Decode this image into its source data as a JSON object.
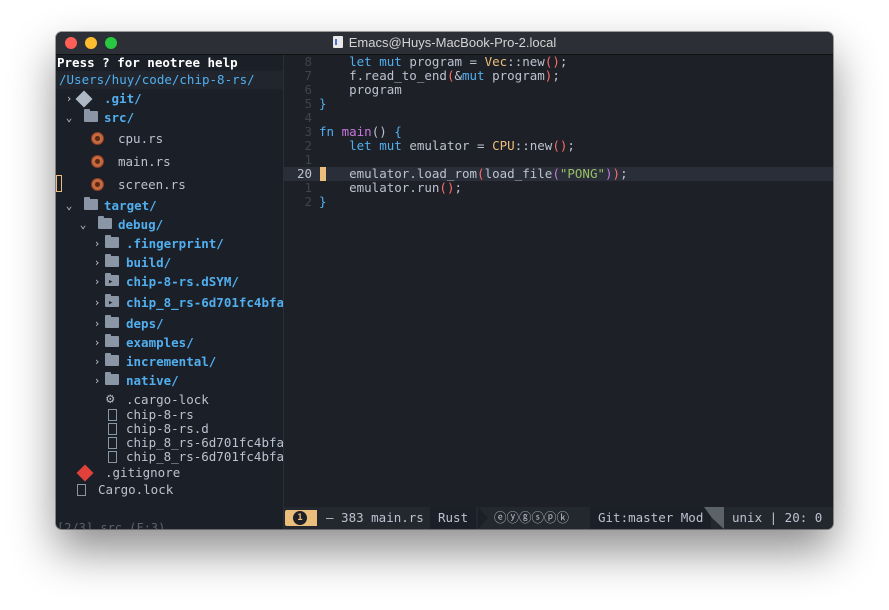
{
  "window": {
    "title": "Emacs@Huys-MacBook-Pro-2.local"
  },
  "sidebar": {
    "help": "Press ? for neotree help",
    "path": "/Users/huy/code/chip-8-rs/",
    "items": [
      {
        "label": ".git/",
        "arrow": "›",
        "icon": "git-icon",
        "kind": "dir"
      },
      {
        "label": "src/",
        "arrow": "⌄",
        "icon": "folder-icon",
        "kind": "dir"
      },
      {
        "label": "cpu.rs",
        "arrow": "",
        "icon": "rust-icon",
        "kind": "file"
      },
      {
        "label": "main.rs",
        "arrow": "",
        "icon": "rust-icon",
        "kind": "file"
      },
      {
        "label": "screen.rs",
        "arrow": "",
        "icon": "rust-icon",
        "kind": "file"
      },
      {
        "label": "target/",
        "arrow": "⌄",
        "icon": "folder-icon",
        "kind": "dir"
      },
      {
        "label": "debug/",
        "arrow": "⌄",
        "icon": "folder-icon",
        "kind": "dir"
      },
      {
        "label": ".fingerprint/",
        "arrow": "›",
        "icon": "folder-icon",
        "kind": "dir"
      },
      {
        "label": "build/",
        "arrow": "›",
        "icon": "folder-icon",
        "kind": "dir"
      },
      {
        "label": "chip-8-rs.dSYM/",
        "arrow": "›",
        "icon": "folder-symlink-icon",
        "kind": "dir"
      },
      {
        "label": "chip_8_rs-6d701fc4bfa $",
        "arrow": "›",
        "icon": "folder-symlink-icon",
        "kind": "dir"
      },
      {
        "label": "deps/",
        "arrow": "›",
        "icon": "folder-icon",
        "kind": "dir"
      },
      {
        "label": "examples/",
        "arrow": "›",
        "icon": "folder-icon",
        "kind": "dir"
      },
      {
        "label": "incremental/",
        "arrow": "›",
        "icon": "folder-icon",
        "kind": "dir"
      },
      {
        "label": "native/",
        "arrow": "›",
        "icon": "folder-icon",
        "kind": "dir"
      },
      {
        "label": ".cargo-lock",
        "arrow": "",
        "icon": "gear-icon",
        "kind": "file"
      },
      {
        "label": "chip-8-rs",
        "arrow": "",
        "icon": "file-icon",
        "kind": "file"
      },
      {
        "label": "chip-8-rs.d",
        "arrow": "",
        "icon": "file-icon",
        "kind": "file"
      },
      {
        "label": "chip_8_rs-6d701fc4bfa $",
        "arrow": "",
        "icon": "file-icon",
        "kind": "file"
      },
      {
        "label": "chip_8_rs-6d701fc4bfa $",
        "arrow": "",
        "icon": "file-icon",
        "kind": "file"
      },
      {
        "label": ".gitignore",
        "arrow": "",
        "icon": "git-icon",
        "kind": "file"
      },
      {
        "label": "Cargo.lock",
        "arrow": "",
        "icon": "file-icon",
        "kind": "file"
      }
    ],
    "status": "[2/3] src (F:3)"
  },
  "editor": {
    "lines": [
      {
        "num": "8",
        "current": false,
        "tokens": [
          [
            "    ",
            ""
          ],
          [
            "let",
            "kw"
          ],
          [
            " ",
            ""
          ],
          [
            "mut",
            "kw"
          ],
          [
            " program = ",
            ""
          ],
          [
            "Vec",
            "tp"
          ],
          [
            "::new",
            ""
          ],
          [
            "(",
            "pr"
          ],
          [
            ")",
            "pr"
          ],
          [
            ";",
            ""
          ]
        ]
      },
      {
        "num": "7",
        "current": false,
        "tokens": [
          [
            "    f.read_to_end",
            ""
          ],
          [
            "(",
            "pr"
          ],
          [
            "&",
            ""
          ],
          [
            "mut",
            "kw"
          ],
          [
            " program",
            ""
          ],
          [
            ")",
            "pr"
          ],
          [
            ";",
            ""
          ]
        ]
      },
      {
        "num": "6",
        "current": false,
        "tokens": [
          [
            "    program",
            ""
          ]
        ]
      },
      {
        "num": "5",
        "current": false,
        "tokens": [
          [
            "}",
            "kw"
          ]
        ]
      },
      {
        "num": "4",
        "current": false,
        "tokens": []
      },
      {
        "num": "3",
        "current": false,
        "tokens": [
          [
            "fn",
            "kw"
          ],
          [
            " ",
            ""
          ],
          [
            "main",
            "fn"
          ],
          [
            "() ",
            ""
          ],
          [
            "{",
            "kw"
          ]
        ]
      },
      {
        "num": "2",
        "current": false,
        "tokens": [
          [
            "    ",
            ""
          ],
          [
            "let",
            "kw"
          ],
          [
            " ",
            ""
          ],
          [
            "mut",
            "kw"
          ],
          [
            " emulator = ",
            ""
          ],
          [
            "CPU",
            "tp"
          ],
          [
            "::new",
            ""
          ],
          [
            "(",
            "pr"
          ],
          [
            ")",
            "pr"
          ],
          [
            ";",
            ""
          ]
        ]
      },
      {
        "num": "1",
        "current": false,
        "tokens": []
      },
      {
        "num": "20",
        "current": true,
        "tokens": [
          [
            "    emulator.load_rom",
            ""
          ],
          [
            "(",
            "pr"
          ],
          [
            "load_file",
            ""
          ],
          [
            "(",
            "fn"
          ],
          [
            "\"PONG\"",
            "st"
          ],
          [
            ")",
            "fn"
          ],
          [
            ")",
            "pr"
          ],
          [
            ";",
            ""
          ]
        ]
      },
      {
        "num": "1",
        "current": false,
        "tokens": [
          [
            "    emulator.run",
            ""
          ],
          [
            "(",
            "pr"
          ],
          [
            ")",
            "pr"
          ],
          [
            ";",
            ""
          ]
        ]
      },
      {
        "num": "2",
        "current": false,
        "tokens": [
          [
            "}",
            "kw"
          ]
        ]
      }
    ]
  },
  "modeline": {
    "window_number": "1",
    "file_info": "– 383 main.rs",
    "mode": "Rust",
    "minor_modes": "ⓔⓨⓖⓢⓟⓚ",
    "vcs": "Git:master Mod",
    "encoding": "unix | 20: 0"
  },
  "colors": {
    "background": "#1d2026",
    "sidebar": "#1b1f27",
    "accent_blue": "#51afef",
    "accent_yellow": "#ecbe7b",
    "keyword_purple": "#c678dd",
    "paren_red": "#ff6c6b",
    "string_green": "#98be65"
  }
}
